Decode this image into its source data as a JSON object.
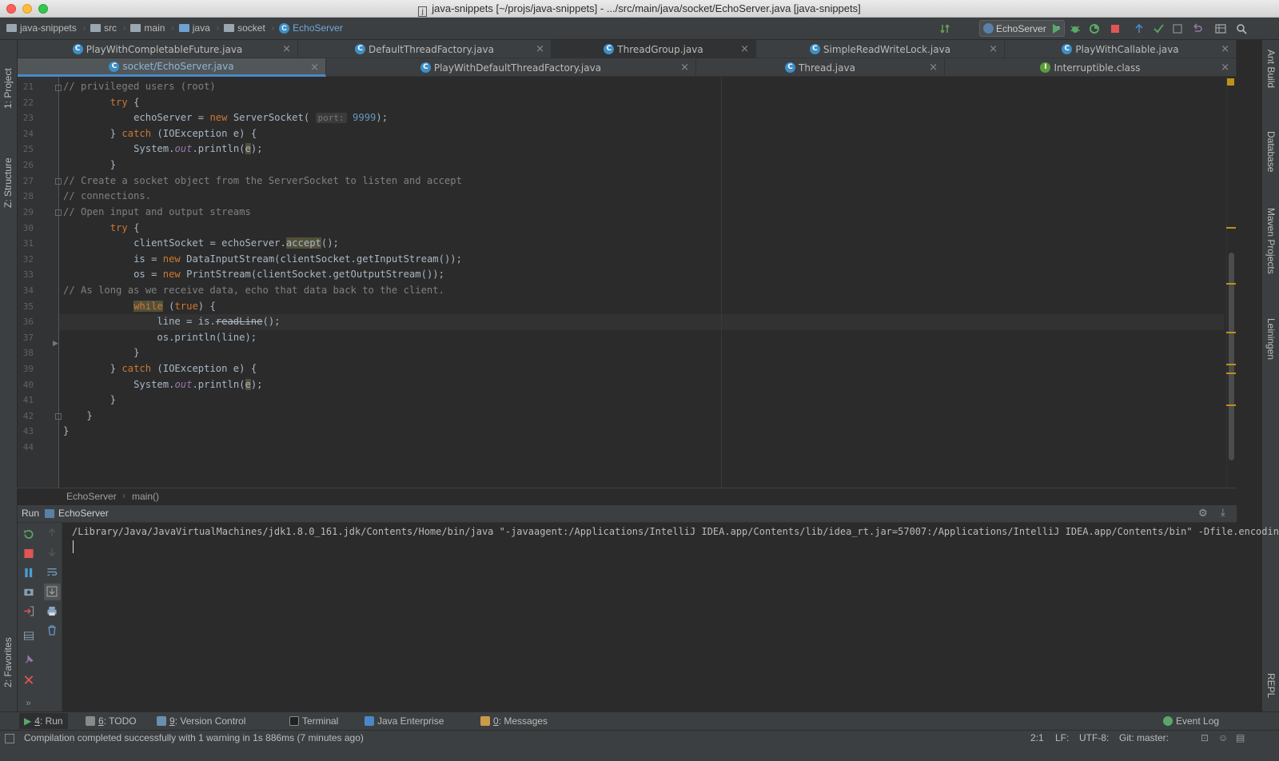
{
  "window": {
    "title": "java-snippets [~/projs/java-snippets] - .../src/main/java/socket/EchoServer.java [java-snippets]"
  },
  "navbar": {
    "crumbs": [
      "java-snippets",
      "src",
      "main",
      "java",
      "socket",
      "EchoServer"
    ],
    "run_config": "EchoServer"
  },
  "tabs_row1": [
    "PlayWithCompletableFuture.java",
    "DefaultThreadFactory.java",
    "ThreadGroup.java",
    "SimpleReadWriteLock.java",
    "PlayWithCallable.java"
  ],
  "tabs_row2": [
    "socket/EchoServer.java",
    "PlayWithDefaultThreadFactory.java",
    "Thread.java",
    "Interruptible.class"
  ],
  "left_tools": [
    "1: Project",
    "Z: Structure",
    "2: Favorites"
  ],
  "right_tools": [
    "Ant Build",
    "Database",
    "Maven Projects",
    "Leiningen",
    "REPL"
  ],
  "editor": {
    "line_numbers": [
      "21",
      "22",
      "23",
      "24",
      "25",
      "26",
      "27",
      "28",
      "29",
      "30",
      "31",
      "32",
      "33",
      "34",
      "35",
      "36",
      "37",
      "38",
      "39",
      "40",
      "41",
      "42",
      "43",
      "44"
    ],
    "lines": {
      "l21": "// privileged users (root)",
      "l27": "// Create a socket object from the ServerSocket to listen and accept",
      "l28": "// connections.",
      "l29": "// Open input and output streams",
      "l34": "// As long as we receive data, echo that data back to the client."
    },
    "tokens": {
      "try": "try",
      "catch": "catch",
      "new": "new",
      "while": "while",
      "true": "true",
      "echoServer": "echoServer",
      "ServerSocket": "ServerSocket(",
      "port_hint": "port:",
      "port_value": "9999",
      "IOException": "(IOException e) {",
      "System": "System.",
      "out": "out",
      "println_e": ".println(",
      "e": "e",
      "close_paren_semi": ");",
      "clientSocket_assign": "clientSocket = echoServer.",
      "accept": "accept",
      "accept_tail": "();",
      "is_assign": "is = ",
      "is_rest": "DataInputStream(clientSocket.getInputStream());",
      "os_assign": "os = ",
      "os_rest": "PrintStream(clientSocket.getOutputStream());",
      "line_assign": "line = is.",
      "readLine": "readLine",
      "os_println": "os.println(line);",
      "open_brace": "{",
      "close_brace": "}",
      "assign_eq": " = "
    }
  },
  "breadcrumb": {
    "cls": "EchoServer",
    "method": "main()"
  },
  "run_panel": {
    "header_label": "Run",
    "config_name": "EchoServer",
    "console_line": "/Library/Java/JavaVirtualMachines/jdk1.8.0_161.jdk/Contents/Home/bin/java \"-javaagent:/Applications/IntelliJ IDEA.app/Contents/lib/idea_rt.jar=57007:/Applications/IntelliJ IDEA.app/Contents/bin\" -Dfile.encoding=U"
  },
  "bottom_tools": {
    "run": {
      "num": "4",
      "label": ": Run"
    },
    "todo": {
      "num": "6",
      "label": ": TODO"
    },
    "vcs": {
      "num": "9",
      "label": ": Version Control"
    },
    "terminal": "Terminal",
    "java_enterprise": "Java Enterprise",
    "messages": {
      "num": "0",
      "label": ": Messages"
    },
    "event_log": "Event Log"
  },
  "status": {
    "message": "Compilation completed successfully with 1 warning in 1s 886ms (7 minutes ago)",
    "position": "2:1",
    "line_sep": "LF:",
    "encoding": "UTF-8:",
    "git": "Git: master:"
  },
  "colors": {
    "accent": "#4a88c7",
    "keyword": "#cc7832",
    "comment": "#808080",
    "number": "#6897bb",
    "field": "#9876aa"
  }
}
